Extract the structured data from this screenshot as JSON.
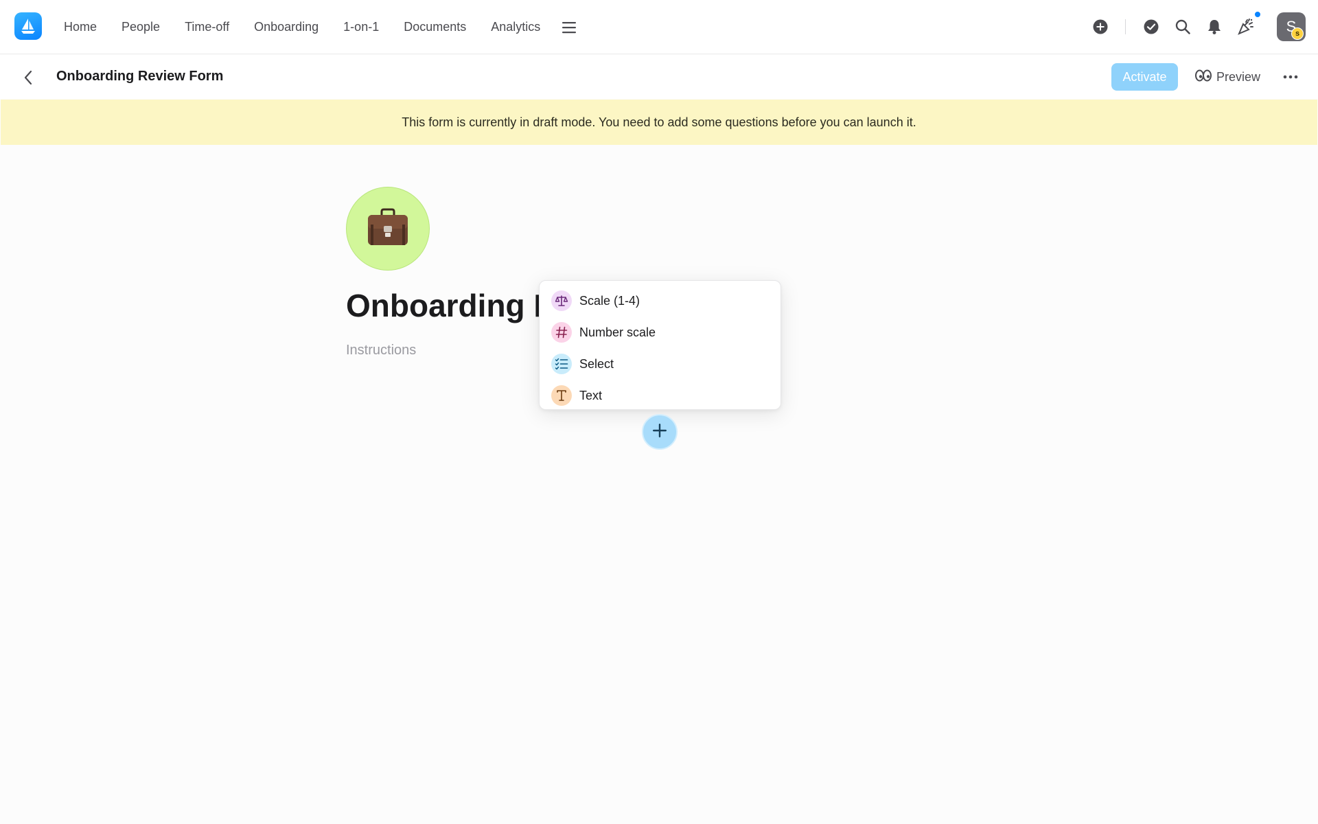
{
  "nav": {
    "items": [
      {
        "label": "Home",
        "id": "home"
      },
      {
        "label": "People",
        "id": "people"
      },
      {
        "label": "Time-off",
        "id": "time-off"
      },
      {
        "label": "Onboarding",
        "id": "onboarding"
      },
      {
        "label": "1-on-1",
        "id": "one-on-one"
      },
      {
        "label": "Documents",
        "id": "documents"
      },
      {
        "label": "Analytics",
        "id": "analytics"
      }
    ],
    "more_icon": "hamburger-icon"
  },
  "top_icons": [
    "add-circle-icon",
    "check-circle-icon",
    "search-icon",
    "bell-icon",
    "party-popper-icon"
  ],
  "user": {
    "avatar_initial": "S",
    "badge_letter": "s"
  },
  "header": {
    "title": "Onboarding Review Form",
    "activate_label": "Activate",
    "preview_label": "Preview"
  },
  "banner": {
    "text": "This form is currently in draft mode. You need to add some questions before you can launch it."
  },
  "form": {
    "icon": "briefcase-icon",
    "title": "Onboarding Review Form",
    "instructions_placeholder": "Instructions"
  },
  "question_menu": {
    "items": [
      {
        "label": "Scale (1-4)",
        "icon": "scale-icon",
        "color": "#f0d9f7"
      },
      {
        "label": "Number scale",
        "icon": "hash-icon",
        "color": "#fbd3e8"
      },
      {
        "label": "Select",
        "icon": "checklist-icon",
        "color": "#c9ecfb"
      },
      {
        "label": "Text",
        "icon": "text-icon",
        "color": "#fcd9b6"
      }
    ]
  },
  "colors": {
    "accent": "#0a84ff",
    "activate_bg": "#8fd2fb",
    "banner_bg": "#fcf6c4",
    "form_icon_bg": "#d2f79a",
    "add_button_bg": "#a8dcfb"
  }
}
